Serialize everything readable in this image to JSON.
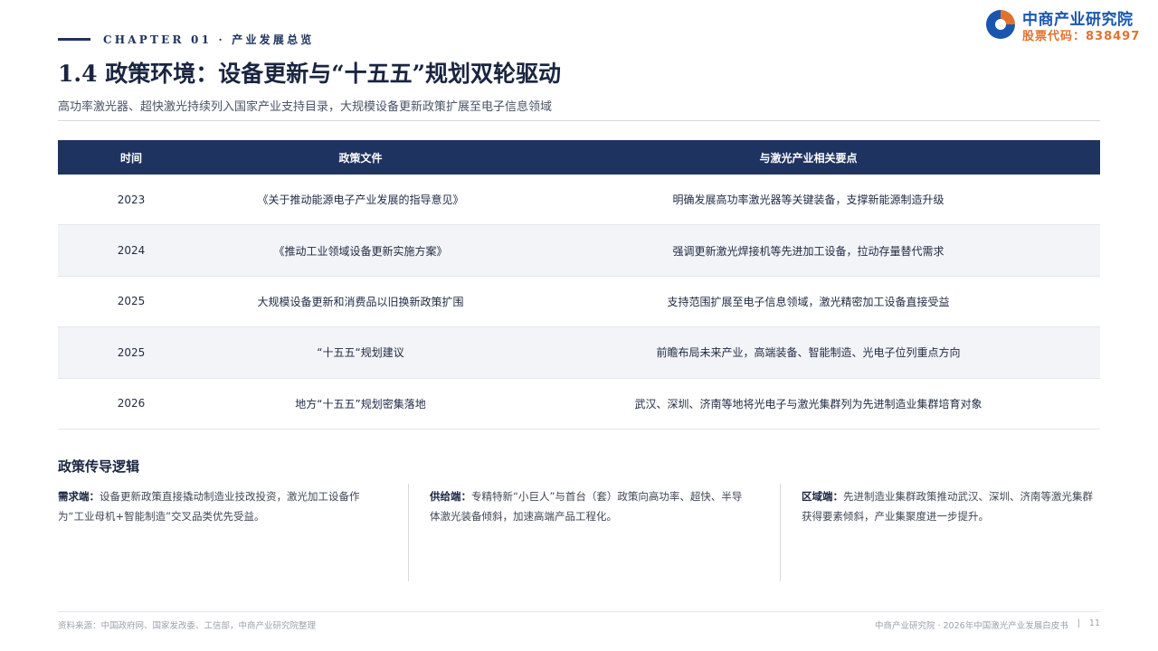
{
  "header": {
    "chapter": "CHAPTER 01 · 产业发展总览",
    "brand_name": "中商产业研究院",
    "brand_code": "股票代码：838497",
    "colors": {
      "navy": "#1f3360",
      "brand_blue": "#1a56b0",
      "brand_orange": "#e2722e"
    }
  },
  "title": "1.4 政策环境：设备更新与“十五五”规划双轮驱动",
  "subtitle": "高功率激光器、超快激光持续列入国家产业支持目录，大规模设备更新政策扩展至电子信息领域",
  "table": {
    "headers": [
      "时间",
      "政策文件",
      "与激光产业相关要点"
    ],
    "rows": [
      [
        "2023",
        "《关于推动能源电子产业发展的指导意见》",
        "明确发展高功率激光器等关键装备，支撑新能源制造升级"
      ],
      [
        "2024",
        "《推动工业领域设备更新实施方案》",
        "强调更新激光焊接机等先进加工设备，拉动存量替代需求"
      ],
      [
        "2025",
        "大规模设备更新和消费品以旧换新政策扩围",
        "支持范围扩展至电子信息领域，激光精密加工设备直接受益"
      ],
      [
        "2025",
        "“十五五“规划建议",
        "前瞻布局未来产业，高端装备、智能制造、光电子位列重点方向"
      ],
      [
        "2026",
        "地方“十五五”规划密集落地",
        "武汉、深圳、济南等地将光电子与激光集群列为先进制造业集群培育对象"
      ]
    ]
  },
  "logic": {
    "title": "政策传导逻辑",
    "items": [
      {
        "key": "需求端：",
        "text": "设备更新政策直接撬动制造业技改投资，激光加工设备作为“工业母机+智能制造”交叉品类优先受益。"
      },
      {
        "key": "供给端：",
        "text": "专精特新“小巨人”与首台（套）政策向高功率、超快、半导体激光装备倾斜，加速高端产品工程化。"
      },
      {
        "key": "区域端：",
        "text": "先进制造业集群政策推动武汉、深圳、济南等激光集群获得要素倾斜，产业集聚度进一步提升。"
      }
    ]
  },
  "footer": {
    "source": "资料来源：中国政府网、国家发改委、工信部，中商产业研究院整理",
    "report": "中商产业研究院 · 2026年中国激光产业发展白皮书",
    "separator": "|",
    "page": "11"
  }
}
